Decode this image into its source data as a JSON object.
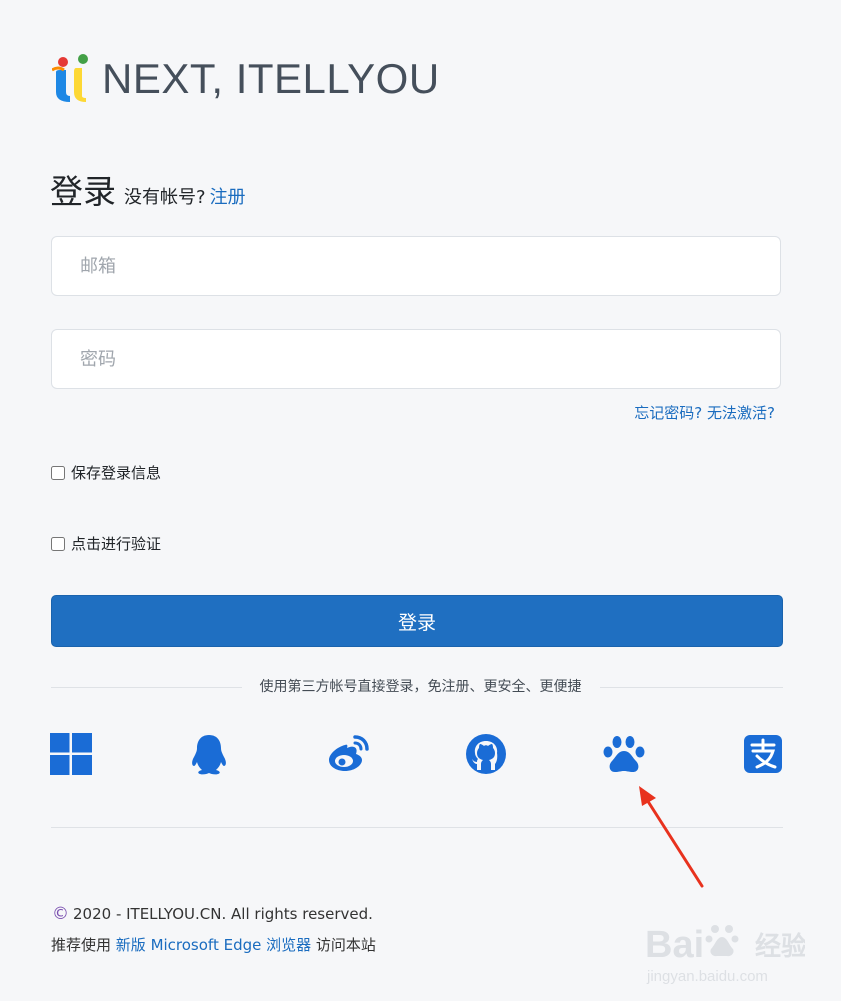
{
  "brand": {
    "name": "NEXT, ITELLYOU"
  },
  "login": {
    "title": "登录",
    "no_account": "没有帐号?",
    "register_link": "注册",
    "email_placeholder": "邮箱",
    "password_placeholder": "密码",
    "forgot_link": "忘记密码? 无法激活?",
    "remember_label": "保存登录信息",
    "verify_label": "点击进行验证",
    "submit_label": "登录"
  },
  "third_party": {
    "divider_text": "使用第三方帐号直接登录，免注册、更安全、更便捷",
    "providers": [
      {
        "name": "windows-icon"
      },
      {
        "name": "qq-icon"
      },
      {
        "name": "weibo-icon"
      },
      {
        "name": "github-icon"
      },
      {
        "name": "baidu-icon"
      },
      {
        "name": "alipay-icon"
      }
    ],
    "icon_color": "#1a6cd6"
  },
  "footer": {
    "copyright": "2020 - ITELLYOU.CN. All rights reserved.",
    "recommend_prefix": "推荐使用",
    "recommend_link": "新版 Microsoft Edge 浏览器",
    "recommend_suffix": "访问本站"
  },
  "annotation": {
    "arrow_color": "#e8321e"
  },
  "watermark": {
    "text": "Baidu经验",
    "subtext": "jingyan.baidu.com"
  },
  "colors": {
    "accent": "#1f6fc1",
    "link": "#1a6cbf",
    "background": "#f6f7f9"
  }
}
